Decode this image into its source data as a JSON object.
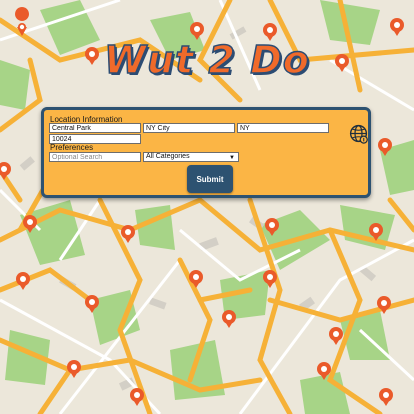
{
  "app": {
    "logo_text": "Wut 2 Do"
  },
  "location": {
    "section_label": "Location Information",
    "street": "Central Park",
    "city": "NY City",
    "state": "NY",
    "zip": "10024"
  },
  "preferences": {
    "section_label": "Preferences",
    "search_placeholder": "Optional Search",
    "category_selected": "All Categories"
  },
  "actions": {
    "submit_label": "Submit"
  },
  "colors": {
    "panel_bg": "#fbb545",
    "panel_border": "#2d5271",
    "logo_fill": "#f06a2a",
    "pin_color": "#ea5a2a",
    "park_green": "#9ed07c",
    "road_orange": "#f7b23b"
  },
  "icons": [
    "globe-icon",
    "map-pin-icon"
  ]
}
